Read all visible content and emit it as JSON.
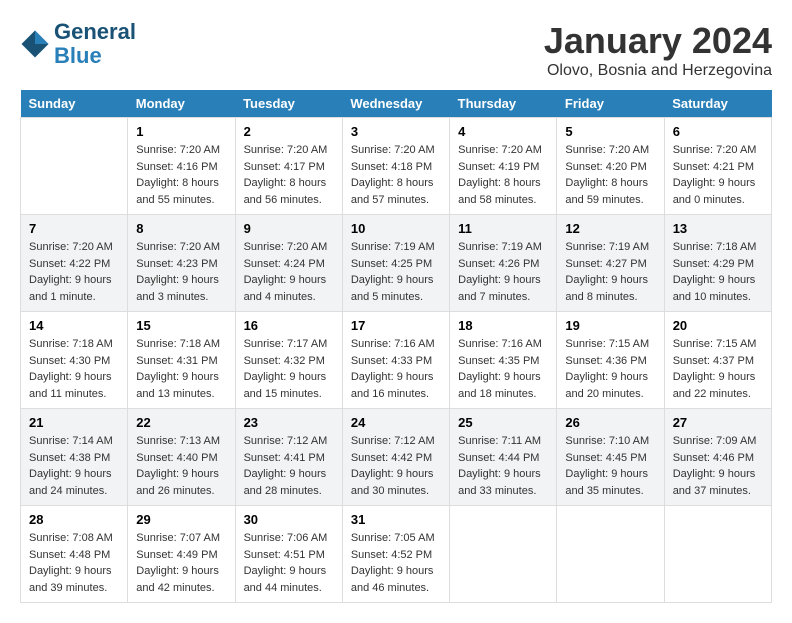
{
  "header": {
    "logo_line1": "General",
    "logo_line2": "Blue",
    "month": "January 2024",
    "location": "Olovo, Bosnia and Herzegovina"
  },
  "weekdays": [
    "Sunday",
    "Monday",
    "Tuesday",
    "Wednesday",
    "Thursday",
    "Friday",
    "Saturday"
  ],
  "weeks": [
    [
      {
        "day": "",
        "sunrise": "",
        "sunset": "",
        "daylight": ""
      },
      {
        "day": "1",
        "sunrise": "Sunrise: 7:20 AM",
        "sunset": "Sunset: 4:16 PM",
        "daylight": "Daylight: 8 hours and 55 minutes."
      },
      {
        "day": "2",
        "sunrise": "Sunrise: 7:20 AM",
        "sunset": "Sunset: 4:17 PM",
        "daylight": "Daylight: 8 hours and 56 minutes."
      },
      {
        "day": "3",
        "sunrise": "Sunrise: 7:20 AM",
        "sunset": "Sunset: 4:18 PM",
        "daylight": "Daylight: 8 hours and 57 minutes."
      },
      {
        "day": "4",
        "sunrise": "Sunrise: 7:20 AM",
        "sunset": "Sunset: 4:19 PM",
        "daylight": "Daylight: 8 hours and 58 minutes."
      },
      {
        "day": "5",
        "sunrise": "Sunrise: 7:20 AM",
        "sunset": "Sunset: 4:20 PM",
        "daylight": "Daylight: 8 hours and 59 minutes."
      },
      {
        "day": "6",
        "sunrise": "Sunrise: 7:20 AM",
        "sunset": "Sunset: 4:21 PM",
        "daylight": "Daylight: 9 hours and 0 minutes."
      }
    ],
    [
      {
        "day": "7",
        "sunrise": "Sunrise: 7:20 AM",
        "sunset": "Sunset: 4:22 PM",
        "daylight": "Daylight: 9 hours and 1 minute."
      },
      {
        "day": "8",
        "sunrise": "Sunrise: 7:20 AM",
        "sunset": "Sunset: 4:23 PM",
        "daylight": "Daylight: 9 hours and 3 minutes."
      },
      {
        "day": "9",
        "sunrise": "Sunrise: 7:20 AM",
        "sunset": "Sunset: 4:24 PM",
        "daylight": "Daylight: 9 hours and 4 minutes."
      },
      {
        "day": "10",
        "sunrise": "Sunrise: 7:19 AM",
        "sunset": "Sunset: 4:25 PM",
        "daylight": "Daylight: 9 hours and 5 minutes."
      },
      {
        "day": "11",
        "sunrise": "Sunrise: 7:19 AM",
        "sunset": "Sunset: 4:26 PM",
        "daylight": "Daylight: 9 hours and 7 minutes."
      },
      {
        "day": "12",
        "sunrise": "Sunrise: 7:19 AM",
        "sunset": "Sunset: 4:27 PM",
        "daylight": "Daylight: 9 hours and 8 minutes."
      },
      {
        "day": "13",
        "sunrise": "Sunrise: 7:18 AM",
        "sunset": "Sunset: 4:29 PM",
        "daylight": "Daylight: 9 hours and 10 minutes."
      }
    ],
    [
      {
        "day": "14",
        "sunrise": "Sunrise: 7:18 AM",
        "sunset": "Sunset: 4:30 PM",
        "daylight": "Daylight: 9 hours and 11 minutes."
      },
      {
        "day": "15",
        "sunrise": "Sunrise: 7:18 AM",
        "sunset": "Sunset: 4:31 PM",
        "daylight": "Daylight: 9 hours and 13 minutes."
      },
      {
        "day": "16",
        "sunrise": "Sunrise: 7:17 AM",
        "sunset": "Sunset: 4:32 PM",
        "daylight": "Daylight: 9 hours and 15 minutes."
      },
      {
        "day": "17",
        "sunrise": "Sunrise: 7:16 AM",
        "sunset": "Sunset: 4:33 PM",
        "daylight": "Daylight: 9 hours and 16 minutes."
      },
      {
        "day": "18",
        "sunrise": "Sunrise: 7:16 AM",
        "sunset": "Sunset: 4:35 PM",
        "daylight": "Daylight: 9 hours and 18 minutes."
      },
      {
        "day": "19",
        "sunrise": "Sunrise: 7:15 AM",
        "sunset": "Sunset: 4:36 PM",
        "daylight": "Daylight: 9 hours and 20 minutes."
      },
      {
        "day": "20",
        "sunrise": "Sunrise: 7:15 AM",
        "sunset": "Sunset: 4:37 PM",
        "daylight": "Daylight: 9 hours and 22 minutes."
      }
    ],
    [
      {
        "day": "21",
        "sunrise": "Sunrise: 7:14 AM",
        "sunset": "Sunset: 4:38 PM",
        "daylight": "Daylight: 9 hours and 24 minutes."
      },
      {
        "day": "22",
        "sunrise": "Sunrise: 7:13 AM",
        "sunset": "Sunset: 4:40 PM",
        "daylight": "Daylight: 9 hours and 26 minutes."
      },
      {
        "day": "23",
        "sunrise": "Sunrise: 7:12 AM",
        "sunset": "Sunset: 4:41 PM",
        "daylight": "Daylight: 9 hours and 28 minutes."
      },
      {
        "day": "24",
        "sunrise": "Sunrise: 7:12 AM",
        "sunset": "Sunset: 4:42 PM",
        "daylight": "Daylight: 9 hours and 30 minutes."
      },
      {
        "day": "25",
        "sunrise": "Sunrise: 7:11 AM",
        "sunset": "Sunset: 4:44 PM",
        "daylight": "Daylight: 9 hours and 33 minutes."
      },
      {
        "day": "26",
        "sunrise": "Sunrise: 7:10 AM",
        "sunset": "Sunset: 4:45 PM",
        "daylight": "Daylight: 9 hours and 35 minutes."
      },
      {
        "day": "27",
        "sunrise": "Sunrise: 7:09 AM",
        "sunset": "Sunset: 4:46 PM",
        "daylight": "Daylight: 9 hours and 37 minutes."
      }
    ],
    [
      {
        "day": "28",
        "sunrise": "Sunrise: 7:08 AM",
        "sunset": "Sunset: 4:48 PM",
        "daylight": "Daylight: 9 hours and 39 minutes."
      },
      {
        "day": "29",
        "sunrise": "Sunrise: 7:07 AM",
        "sunset": "Sunset: 4:49 PM",
        "daylight": "Daylight: 9 hours and 42 minutes."
      },
      {
        "day": "30",
        "sunrise": "Sunrise: 7:06 AM",
        "sunset": "Sunset: 4:51 PM",
        "daylight": "Daylight: 9 hours and 44 minutes."
      },
      {
        "day": "31",
        "sunrise": "Sunrise: 7:05 AM",
        "sunset": "Sunset: 4:52 PM",
        "daylight": "Daylight: 9 hours and 46 minutes."
      },
      {
        "day": "",
        "sunrise": "",
        "sunset": "",
        "daylight": ""
      },
      {
        "day": "",
        "sunrise": "",
        "sunset": "",
        "daylight": ""
      },
      {
        "day": "",
        "sunrise": "",
        "sunset": "",
        "daylight": ""
      }
    ]
  ]
}
